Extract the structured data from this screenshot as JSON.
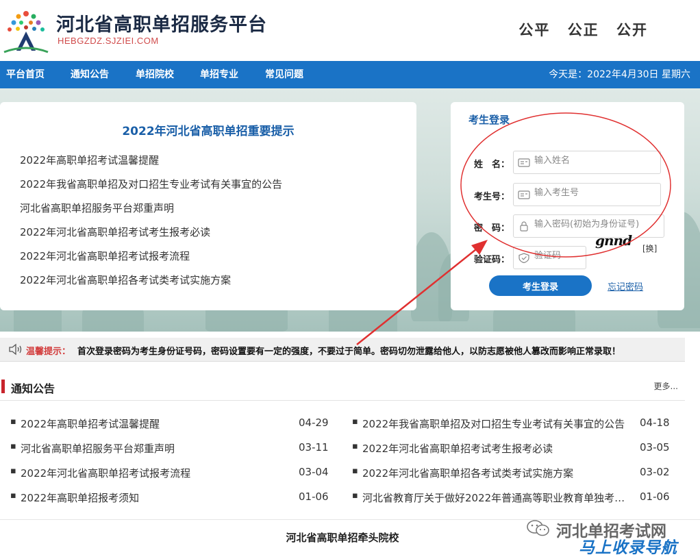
{
  "header": {
    "title": "河北省高职单招服务平台",
    "domain": "HEBGZDZ.SJZIEI.COM",
    "slogan": [
      "公平",
      "公正",
      "公开"
    ]
  },
  "nav": {
    "items": [
      "平台首页",
      "通知公告",
      "单招院校",
      "单招专业",
      "常见问题"
    ],
    "date": "今天是：2022年4月30日 星期六"
  },
  "tips": {
    "title": "2022年河北省高职单招重要提示",
    "items": [
      "2022年高职单招考试温馨提醒",
      "2022年我省高职单招及对口招生专业考试有关事宜的公告",
      "河北省高职单招服务平台郑重声明",
      "2022年河北省高职单招考试考生报考必读",
      "2022年河北省高职单招考试报考流程",
      "2022年河北省高职单招各考试类考试实施方案"
    ]
  },
  "login": {
    "title": "考生登录",
    "name_label": "姓　名：",
    "name_placeholder": "输入姓名",
    "id_label": "考生号：",
    "id_placeholder": "输入考生号",
    "password_label": "密　码：",
    "password_placeholder": "输入密码(初始为身份证号)",
    "captcha_label": "验证码：",
    "captcha_placeholder": "验证码",
    "captcha_text": "gnnd",
    "refresh_label": "[换]",
    "submit_label": "考生登录",
    "forgot_label": "忘记密码"
  },
  "warm_tip": {
    "label": "温馨提示：",
    "text": "首次登录密码为考生身份证号码，密码设置要有一定的强度，不要过于简单。密码切勿泄露给他人，以防志愿被他人篡改而影响正常录取！"
  },
  "notices": {
    "title": "通知公告",
    "more": "更多...",
    "left": [
      {
        "text": "2022年高职单招考试温馨提醒",
        "date": "04-29"
      },
      {
        "text": "河北省高职单招服务平台郑重声明",
        "date": "03-11"
      },
      {
        "text": "2022年河北省高职单招考试报考流程",
        "date": "03-04"
      },
      {
        "text": "2022年高职单招报考须知",
        "date": "01-06"
      }
    ],
    "right": [
      {
        "text": "2022年我省高职单招及对口招生专业考试有关事宜的公告",
        "date": "04-18"
      },
      {
        "text": "2022年河北省高职单招考试考生报考必读",
        "date": "03-05"
      },
      {
        "text": "2022年河北省高职单招各考试类考试实施方案",
        "date": "03-02"
      },
      {
        "text": "河北省教育厅关于做好2022年普通高等职业教育单独考…",
        "date": "01-06"
      }
    ]
  },
  "footer": {
    "title": "河北省高职单招牵头院校"
  },
  "watermark": {
    "text": "河北单招考试网",
    "logo": "马上收录导航"
  },
  "colors": {
    "nav_blue": "#1a73c6",
    "link_blue": "#1a5fa8",
    "accent_red": "#c8242c",
    "annotation_red": "#e03030"
  }
}
